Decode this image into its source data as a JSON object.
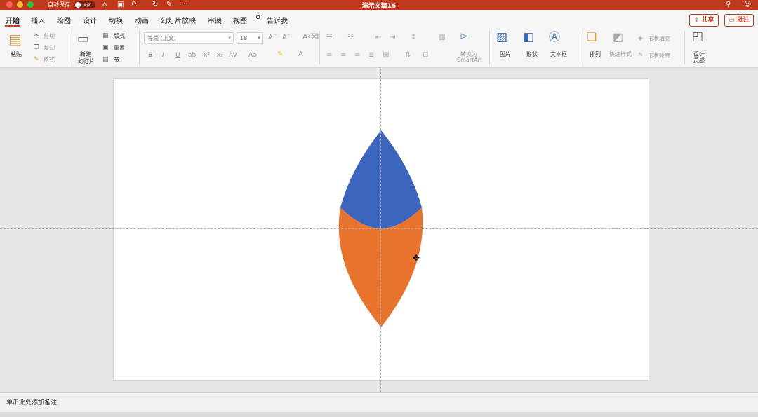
{
  "titlebar": {
    "autosave_label": "自动保存",
    "autosave_state": "关闭",
    "doc_title": "演示文稿16",
    "icons": [
      "home-icon",
      "save-icon",
      "undo-icon",
      "redo-icon",
      "print-icon",
      "more-icon"
    ],
    "more": "···",
    "bg_color": "#c0391b"
  },
  "tabs": {
    "items": [
      "开始",
      "插入",
      "绘图",
      "设计",
      "切换",
      "动画",
      "幻灯片放映",
      "审阅",
      "视图"
    ],
    "active": "开始",
    "tell_me": "告诉我",
    "share": "共享",
    "comment": "批注"
  },
  "ribbon": {
    "paste": "粘贴",
    "cut": "剪切",
    "copy": "复制",
    "format": "格式",
    "new_slide_line1": "新建",
    "new_slide_line2": "幻灯片",
    "layout": "版式",
    "reset": "重置",
    "section": "节",
    "font_name": "等线 (正文)",
    "font_size": "18",
    "smartart_line1": "转换为",
    "smartart_line2": "SmartArt",
    "picture": "图片",
    "shapes": "形状",
    "textbox": "文本框",
    "arrange": "排列",
    "quick_styles": "快速样式",
    "shape_fill": "形状填充",
    "shape_outline": "形状轮廓",
    "designer_line1": "设计",
    "designer_line2": "灵感"
  },
  "slide": {
    "shape_colors": {
      "top": "#3c66be",
      "bottom": "#e8732d"
    }
  },
  "notes": {
    "placeholder": "单击此处添加备注"
  }
}
